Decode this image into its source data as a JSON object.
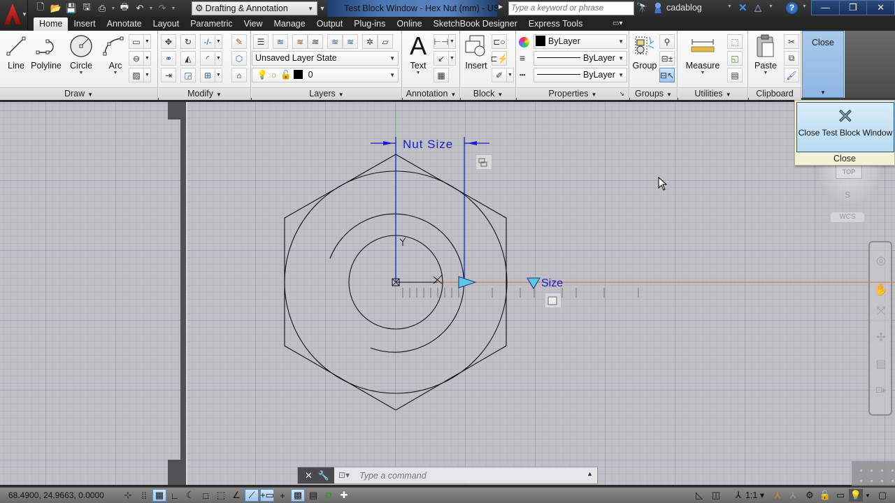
{
  "titlebar": {
    "workspace": "Drafting & Annotation",
    "document_title": "Test Block Window - Hex Nut (mm) - US",
    "search_placeholder": "Type a keyword or phrase",
    "user": "cadablog",
    "help": "?",
    "window_controls": [
      "—",
      "❐",
      "✕"
    ]
  },
  "tabs": [
    {
      "label": "Home",
      "active": true
    },
    {
      "label": "Insert"
    },
    {
      "label": "Annotate"
    },
    {
      "label": "Layout"
    },
    {
      "label": "Parametric"
    },
    {
      "label": "View"
    },
    {
      "label": "Manage"
    },
    {
      "label": "Output"
    },
    {
      "label": "Plug-ins"
    },
    {
      "label": "Online"
    },
    {
      "label": "SketchBook Designer"
    },
    {
      "label": "Express Tools"
    }
  ],
  "ribbon": {
    "draw": {
      "title": "Draw",
      "line": "Line",
      "polyline": "Polyline",
      "circle": "Circle",
      "arc": "Arc"
    },
    "modify": {
      "title": "Modify"
    },
    "layers": {
      "title": "Layers",
      "layer_state": "Unsaved Layer State",
      "current_layer": "0"
    },
    "annotation": {
      "title": "Annotation",
      "text": "Text"
    },
    "block": {
      "title": "Block",
      "insert": "Insert"
    },
    "properties": {
      "title": "Properties",
      "color": "ByLayer",
      "lineweight": "ByLayer",
      "linetype": "ByLayer"
    },
    "groups": {
      "title": "Groups",
      "group": "Group"
    },
    "utilities": {
      "title": "Utilities",
      "measure": "Measure"
    },
    "clipboard": {
      "title": "Clipboard",
      "paste": "Paste"
    },
    "close": {
      "title": "Close"
    }
  },
  "flyout": {
    "button": "Close Test Block Window",
    "footer": "Close"
  },
  "viewcube": {
    "top": "TOP",
    "south": "S",
    "wcs": "WCS"
  },
  "drawing": {
    "dimension_label": "Nut Size",
    "parameter_label": "Size",
    "colors": {
      "geometry": "#111111",
      "dimension": "#1a1acc",
      "grip": "#5ec4f0",
      "tracking": "#d06a50"
    }
  },
  "command_line": {
    "placeholder": "Type a command"
  },
  "statusbar": {
    "coordinates": "68.4900, 24.9663, 0.0000",
    "annotation_scale": "1:1"
  }
}
